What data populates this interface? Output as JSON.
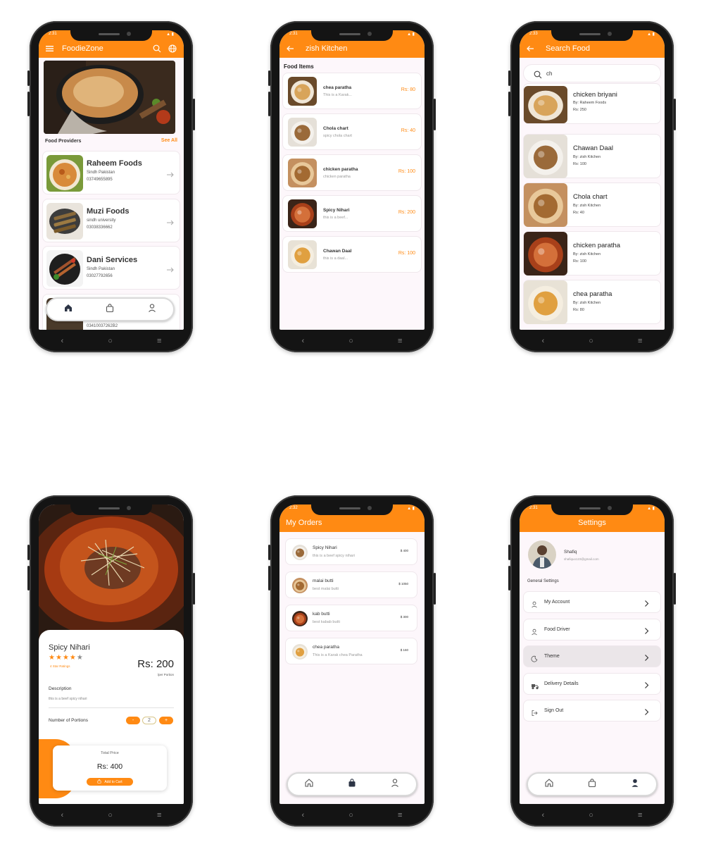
{
  "screen1": {
    "status_time": "2:31",
    "app_title": "FoodieZone",
    "section_title": "Food Providers",
    "see_all": "See All",
    "providers": [
      {
        "name": "Raheem Foods",
        "location": "Sindh Pakistan",
        "phone": "03749655895"
      },
      {
        "name": "Muzi Foods",
        "location": "sindh university",
        "phone": "03038336662"
      },
      {
        "name": "Dani Services",
        "location": "Sindh Pakistan",
        "phone": "03027792656"
      }
    ],
    "partial_phone": "03410037262B2"
  },
  "screen2": {
    "status_time": "2:31",
    "title": "zish Kitchen",
    "section_title": "Food Items",
    "items": [
      {
        "name": "chea paratha",
        "desc": "This is a Karak...",
        "price": "Rs: 80"
      },
      {
        "name": "Chola chart",
        "desc": "spicy chola chart",
        "price": "Rs: 40"
      },
      {
        "name": "chicken paratha",
        "desc": "chicken paratha",
        "price": "Rs: 100"
      },
      {
        "name": "Spicy Nihari",
        "desc": "this is a beef...",
        "price": "Rs: 200"
      },
      {
        "name": "Chawan Daal",
        "desc": "this is a daal...",
        "price": "Rs: 100"
      }
    ]
  },
  "screen3": {
    "status_time": "2:33",
    "title": "Search Food",
    "search_value": "ch",
    "results": [
      {
        "name": "chicken briyani",
        "by": "By: Raheem Foods",
        "price": "Rs: 250"
      },
      {
        "name": "Chawan Daal",
        "by": "By: zish Kitchen",
        "price": "Rs: 100"
      },
      {
        "name": "Chola chart",
        "by": "By: zish Kitchen",
        "price": "Rs: 40"
      },
      {
        "name": "chicken paratha",
        "by": "By: zish Kitchen",
        "price": "Rs: 100"
      },
      {
        "name": "chea paratha",
        "by": "By: zish Kitchen",
        "price": "Rs: 80"
      }
    ]
  },
  "screen4": {
    "dish_name": "Spicy Nihari",
    "rating_text": "4 Star Ratings",
    "rating": 4,
    "rating_max": 5,
    "price": "Rs: 200",
    "per_portion": "/per Portion",
    "description_label": "Description",
    "description": "this is a beef spicy nihari",
    "portions_label": "Number of Portions",
    "minus": "-",
    "portions": "2",
    "plus": "+",
    "total_label": "Total Price",
    "total": "Rs: 400",
    "add_to_cart": "Add to Cart"
  },
  "screen5": {
    "status_time": "2:32",
    "title": "My Orders",
    "orders": [
      {
        "name": "Spicy Nihari",
        "desc": "this is a beef spicy nihari",
        "price": "$ 400"
      },
      {
        "name": "malai butti",
        "desc": "best malai butti",
        "price": "$ 1050"
      },
      {
        "name": "kab butti",
        "desc": "best kabab butti",
        "price": "$ 300"
      },
      {
        "name": "chea paratha",
        "desc": "This is a Karak chea Paratha",
        "price": "$ 160"
      }
    ]
  },
  "screen6": {
    "status_time": "2:31",
    "title": "Settings",
    "user_name": "Shafiq",
    "user_email": "shafiquo123@gmail.com",
    "section_title": "General Settings",
    "options": [
      {
        "label": "My Account",
        "icon": "user-icon"
      },
      {
        "label": "Food Driver",
        "icon": "user-icon"
      },
      {
        "label": "Theme",
        "icon": "moon-icon"
      },
      {
        "label": "Delivery Details",
        "icon": "delivery-icon"
      },
      {
        "label": "Sign Out",
        "icon": "logout-icon"
      }
    ]
  },
  "colors": {
    "accent": "#ff8a13",
    "screen_bg": "#fdf7fb",
    "phone_frame": "#141414"
  }
}
